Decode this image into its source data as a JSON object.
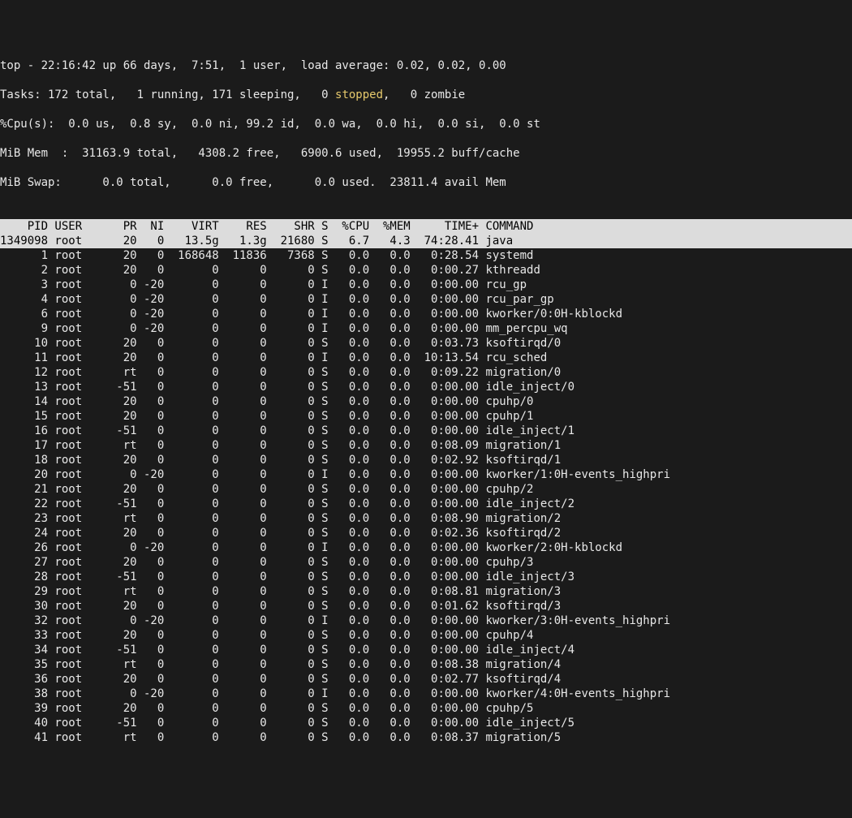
{
  "header": {
    "time": "22:16:42",
    "uptime": "66 days,  7:51",
    "users": "1 user",
    "load": "0.02, 0.02, 0.00",
    "tasks": {
      "total": "172",
      "running": "1",
      "sleeping": "171",
      "stopped": "0",
      "zombie": "0"
    },
    "cpu": {
      "us": "0.0",
      "sy": "0.8",
      "ni": "0.0",
      "id": "99.2",
      "wa": "0.0",
      "hi": "0.0",
      "si": "0.0",
      "st": "0.0"
    },
    "mem": {
      "label": "MiB Mem ",
      "total": "31163.9",
      "free": "4308.2",
      "used": "6900.6",
      "cache": "19955.2"
    },
    "swap": {
      "label": "MiB Swap",
      "total": "0.0",
      "free": "0.0",
      "used": "0.0",
      "avail": "23811.4"
    }
  },
  "columns": [
    "PID",
    "USER",
    "PR",
    "NI",
    "VIRT",
    "RES",
    "SHR",
    "S",
    "%CPU",
    "%MEM",
    "TIME+",
    "COMMAND"
  ],
  "rows": [
    {
      "pid": "1349098",
      "user": "root",
      "pr": "20",
      "ni": "0",
      "virt": "13.5g",
      "res": "1.3g",
      "shr": "21680",
      "s": "S",
      "cpu": "6.7",
      "mem": "4.3",
      "time": "74:28.41",
      "cmd": "java",
      "sel": true
    },
    {
      "pid": "1",
      "user": "root",
      "pr": "20",
      "ni": "0",
      "virt": "168648",
      "res": "11836",
      "shr": "7368",
      "s": "S",
      "cpu": "0.0",
      "mem": "0.0",
      "time": "0:28.54",
      "cmd": "systemd"
    },
    {
      "pid": "2",
      "user": "root",
      "pr": "20",
      "ni": "0",
      "virt": "0",
      "res": "0",
      "shr": "0",
      "s": "S",
      "cpu": "0.0",
      "mem": "0.0",
      "time": "0:00.27",
      "cmd": "kthreadd"
    },
    {
      "pid": "3",
      "user": "root",
      "pr": "0",
      "ni": "-20",
      "virt": "0",
      "res": "0",
      "shr": "0",
      "s": "I",
      "cpu": "0.0",
      "mem": "0.0",
      "time": "0:00.00",
      "cmd": "rcu_gp"
    },
    {
      "pid": "4",
      "user": "root",
      "pr": "0",
      "ni": "-20",
      "virt": "0",
      "res": "0",
      "shr": "0",
      "s": "I",
      "cpu": "0.0",
      "mem": "0.0",
      "time": "0:00.00",
      "cmd": "rcu_par_gp"
    },
    {
      "pid": "6",
      "user": "root",
      "pr": "0",
      "ni": "-20",
      "virt": "0",
      "res": "0",
      "shr": "0",
      "s": "I",
      "cpu": "0.0",
      "mem": "0.0",
      "time": "0:00.00",
      "cmd": "kworker/0:0H-kblockd"
    },
    {
      "pid": "9",
      "user": "root",
      "pr": "0",
      "ni": "-20",
      "virt": "0",
      "res": "0",
      "shr": "0",
      "s": "I",
      "cpu": "0.0",
      "mem": "0.0",
      "time": "0:00.00",
      "cmd": "mm_percpu_wq"
    },
    {
      "pid": "10",
      "user": "root",
      "pr": "20",
      "ni": "0",
      "virt": "0",
      "res": "0",
      "shr": "0",
      "s": "S",
      "cpu": "0.0",
      "mem": "0.0",
      "time": "0:03.73",
      "cmd": "ksoftirqd/0"
    },
    {
      "pid": "11",
      "user": "root",
      "pr": "20",
      "ni": "0",
      "virt": "0",
      "res": "0",
      "shr": "0",
      "s": "I",
      "cpu": "0.0",
      "mem": "0.0",
      "time": "10:13.54",
      "cmd": "rcu_sched"
    },
    {
      "pid": "12",
      "user": "root",
      "pr": "rt",
      "ni": "0",
      "virt": "0",
      "res": "0",
      "shr": "0",
      "s": "S",
      "cpu": "0.0",
      "mem": "0.0",
      "time": "0:09.22",
      "cmd": "migration/0"
    },
    {
      "pid": "13",
      "user": "root",
      "pr": "-51",
      "ni": "0",
      "virt": "0",
      "res": "0",
      "shr": "0",
      "s": "S",
      "cpu": "0.0",
      "mem": "0.0",
      "time": "0:00.00",
      "cmd": "idle_inject/0"
    },
    {
      "pid": "14",
      "user": "root",
      "pr": "20",
      "ni": "0",
      "virt": "0",
      "res": "0",
      "shr": "0",
      "s": "S",
      "cpu": "0.0",
      "mem": "0.0",
      "time": "0:00.00",
      "cmd": "cpuhp/0"
    },
    {
      "pid": "15",
      "user": "root",
      "pr": "20",
      "ni": "0",
      "virt": "0",
      "res": "0",
      "shr": "0",
      "s": "S",
      "cpu": "0.0",
      "mem": "0.0",
      "time": "0:00.00",
      "cmd": "cpuhp/1"
    },
    {
      "pid": "16",
      "user": "root",
      "pr": "-51",
      "ni": "0",
      "virt": "0",
      "res": "0",
      "shr": "0",
      "s": "S",
      "cpu": "0.0",
      "mem": "0.0",
      "time": "0:00.00",
      "cmd": "idle_inject/1"
    },
    {
      "pid": "17",
      "user": "root",
      "pr": "rt",
      "ni": "0",
      "virt": "0",
      "res": "0",
      "shr": "0",
      "s": "S",
      "cpu": "0.0",
      "mem": "0.0",
      "time": "0:08.09",
      "cmd": "migration/1"
    },
    {
      "pid": "18",
      "user": "root",
      "pr": "20",
      "ni": "0",
      "virt": "0",
      "res": "0",
      "shr": "0",
      "s": "S",
      "cpu": "0.0",
      "mem": "0.0",
      "time": "0:02.92",
      "cmd": "ksoftirqd/1"
    },
    {
      "pid": "20",
      "user": "root",
      "pr": "0",
      "ni": "-20",
      "virt": "0",
      "res": "0",
      "shr": "0",
      "s": "I",
      "cpu": "0.0",
      "mem": "0.0",
      "time": "0:00.00",
      "cmd": "kworker/1:0H-events_highpri"
    },
    {
      "pid": "21",
      "user": "root",
      "pr": "20",
      "ni": "0",
      "virt": "0",
      "res": "0",
      "shr": "0",
      "s": "S",
      "cpu": "0.0",
      "mem": "0.0",
      "time": "0:00.00",
      "cmd": "cpuhp/2"
    },
    {
      "pid": "22",
      "user": "root",
      "pr": "-51",
      "ni": "0",
      "virt": "0",
      "res": "0",
      "shr": "0",
      "s": "S",
      "cpu": "0.0",
      "mem": "0.0",
      "time": "0:00.00",
      "cmd": "idle_inject/2"
    },
    {
      "pid": "23",
      "user": "root",
      "pr": "rt",
      "ni": "0",
      "virt": "0",
      "res": "0",
      "shr": "0",
      "s": "S",
      "cpu": "0.0",
      "mem": "0.0",
      "time": "0:08.90",
      "cmd": "migration/2"
    },
    {
      "pid": "24",
      "user": "root",
      "pr": "20",
      "ni": "0",
      "virt": "0",
      "res": "0",
      "shr": "0",
      "s": "S",
      "cpu": "0.0",
      "mem": "0.0",
      "time": "0:02.36",
      "cmd": "ksoftirqd/2"
    },
    {
      "pid": "26",
      "user": "root",
      "pr": "0",
      "ni": "-20",
      "virt": "0",
      "res": "0",
      "shr": "0",
      "s": "I",
      "cpu": "0.0",
      "mem": "0.0",
      "time": "0:00.00",
      "cmd": "kworker/2:0H-kblockd"
    },
    {
      "pid": "27",
      "user": "root",
      "pr": "20",
      "ni": "0",
      "virt": "0",
      "res": "0",
      "shr": "0",
      "s": "S",
      "cpu": "0.0",
      "mem": "0.0",
      "time": "0:00.00",
      "cmd": "cpuhp/3"
    },
    {
      "pid": "28",
      "user": "root",
      "pr": "-51",
      "ni": "0",
      "virt": "0",
      "res": "0",
      "shr": "0",
      "s": "S",
      "cpu": "0.0",
      "mem": "0.0",
      "time": "0:00.00",
      "cmd": "idle_inject/3"
    },
    {
      "pid": "29",
      "user": "root",
      "pr": "rt",
      "ni": "0",
      "virt": "0",
      "res": "0",
      "shr": "0",
      "s": "S",
      "cpu": "0.0",
      "mem": "0.0",
      "time": "0:08.81",
      "cmd": "migration/3"
    },
    {
      "pid": "30",
      "user": "root",
      "pr": "20",
      "ni": "0",
      "virt": "0",
      "res": "0",
      "shr": "0",
      "s": "S",
      "cpu": "0.0",
      "mem": "0.0",
      "time": "0:01.62",
      "cmd": "ksoftirqd/3"
    },
    {
      "pid": "32",
      "user": "root",
      "pr": "0",
      "ni": "-20",
      "virt": "0",
      "res": "0",
      "shr": "0",
      "s": "I",
      "cpu": "0.0",
      "mem": "0.0",
      "time": "0:00.00",
      "cmd": "kworker/3:0H-events_highpri"
    },
    {
      "pid": "33",
      "user": "root",
      "pr": "20",
      "ni": "0",
      "virt": "0",
      "res": "0",
      "shr": "0",
      "s": "S",
      "cpu": "0.0",
      "mem": "0.0",
      "time": "0:00.00",
      "cmd": "cpuhp/4"
    },
    {
      "pid": "34",
      "user": "root",
      "pr": "-51",
      "ni": "0",
      "virt": "0",
      "res": "0",
      "shr": "0",
      "s": "S",
      "cpu": "0.0",
      "mem": "0.0",
      "time": "0:00.00",
      "cmd": "idle_inject/4"
    },
    {
      "pid": "35",
      "user": "root",
      "pr": "rt",
      "ni": "0",
      "virt": "0",
      "res": "0",
      "shr": "0",
      "s": "S",
      "cpu": "0.0",
      "mem": "0.0",
      "time": "0:08.38",
      "cmd": "migration/4"
    },
    {
      "pid": "36",
      "user": "root",
      "pr": "20",
      "ni": "0",
      "virt": "0",
      "res": "0",
      "shr": "0",
      "s": "S",
      "cpu": "0.0",
      "mem": "0.0",
      "time": "0:02.77",
      "cmd": "ksoftirqd/4"
    },
    {
      "pid": "38",
      "user": "root",
      "pr": "0",
      "ni": "-20",
      "virt": "0",
      "res": "0",
      "shr": "0",
      "s": "I",
      "cpu": "0.0",
      "mem": "0.0",
      "time": "0:00.00",
      "cmd": "kworker/4:0H-events_highpri"
    },
    {
      "pid": "39",
      "user": "root",
      "pr": "20",
      "ni": "0",
      "virt": "0",
      "res": "0",
      "shr": "0",
      "s": "S",
      "cpu": "0.0",
      "mem": "0.0",
      "time": "0:00.00",
      "cmd": "cpuhp/5"
    },
    {
      "pid": "40",
      "user": "root",
      "pr": "-51",
      "ni": "0",
      "virt": "0",
      "res": "0",
      "shr": "0",
      "s": "S",
      "cpu": "0.0",
      "mem": "0.0",
      "time": "0:00.00",
      "cmd": "idle_inject/5"
    },
    {
      "pid": "41",
      "user": "root",
      "pr": "rt",
      "ni": "0",
      "virt": "0",
      "res": "0",
      "shr": "0",
      "s": "S",
      "cpu": "0.0",
      "mem": "0.0",
      "time": "0:08.37",
      "cmd": "migration/5"
    }
  ]
}
